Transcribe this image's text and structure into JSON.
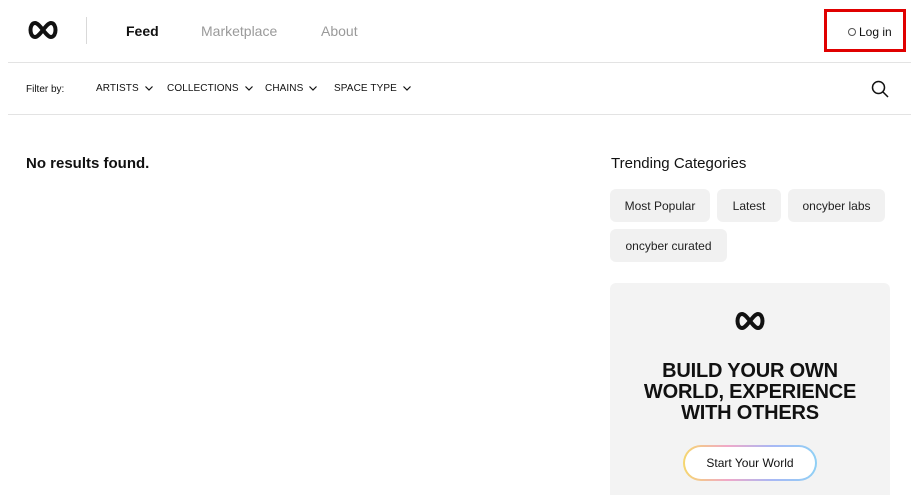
{
  "header": {
    "nav": [
      {
        "label": "Feed",
        "active": true
      },
      {
        "label": "Marketplace",
        "active": false
      },
      {
        "label": "About",
        "active": false
      }
    ],
    "login_label": "Log in",
    "login_highlight_color": "#e00000"
  },
  "filters": {
    "label": "Filter by:",
    "dropdowns": [
      "ARTISTS",
      "COLLECTIONS",
      "CHAINS",
      "SPACE TYPE"
    ]
  },
  "main": {
    "empty_message": "No results found."
  },
  "sidebar": {
    "trending_title": "Trending Categories",
    "categories": [
      "Most Popular",
      "Latest",
      "oncyber labs",
      "oncyber curated"
    ],
    "promo": {
      "headline_lines": [
        "BUILD YOUR OWN",
        "WORLD, EXPERIENCE",
        "WITH OTHERS"
      ],
      "cta_label": "Start Your World"
    }
  },
  "icons": {
    "logo": "infinity-logo-icon",
    "search": "search-icon",
    "chevron": "chevron-down-icon",
    "login": "circle-icon"
  }
}
